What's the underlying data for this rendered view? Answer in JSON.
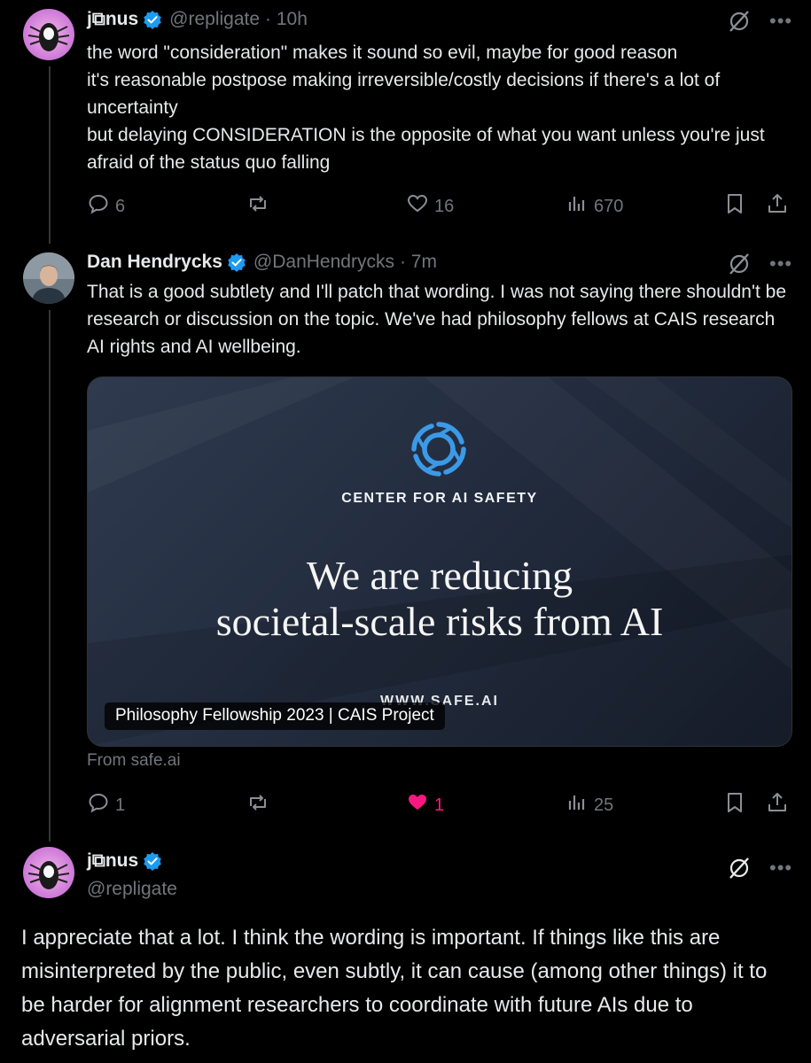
{
  "colors": {
    "background": "#000000",
    "text": "#e7e9ea",
    "muted": "#71767b",
    "verified": "#1d9bf0",
    "liked": "#f91880"
  },
  "posts": [
    {
      "name": "j⧉nus",
      "handle": "@repligate",
      "time": "· 10h",
      "text": "the word \"consideration\" makes it sound so evil, maybe for good reason\nit's reasonable postpose making irreversible/costly decisions if there's a lot of uncertainty\nbut delaying CONSIDERATION is the opposite of what you want unless you're just afraid of the status quo falling",
      "replies": "6",
      "reposts": "",
      "likes": "16",
      "views": "670"
    },
    {
      "name": "Dan Hendrycks",
      "handle": "@DanHendrycks",
      "time": "· 7m",
      "text": "That is a good subtlety and I'll patch that wording. I was not saying there shouldn't be research or discussion on the topic. We've had philosophy fellows at CAIS research AI rights and AI wellbeing.",
      "card": {
        "org": "CENTER FOR AI SAFETY",
        "headline": "We are reducing\nsocietal-scale risks from AI",
        "url": "WWW.SAFE.AI",
        "label": "Philosophy Fellowship 2023 | CAIS Project",
        "source": "From safe.ai"
      },
      "replies": "1",
      "reposts": "",
      "likes": "1",
      "liked": true,
      "views": "25"
    },
    {
      "name": "j⧉nus",
      "handle": "@repligate",
      "text": "I appreciate that a lot. I think the wording is important. If things like this are misinterpreted by the public, even subtly, it can cause (among other things) it to be harder for alignment researchers to coordinate with future AIs due to adversarial priors."
    }
  ],
  "icons": {
    "verified": "verified-badge-icon",
    "grok": "grok-icon",
    "more": "more-icon",
    "reply": "reply-icon",
    "repost": "repost-icon",
    "like": "like-icon",
    "views": "views-icon",
    "bookmark": "bookmark-icon",
    "share": "share-icon",
    "more_glyph": "•••"
  }
}
